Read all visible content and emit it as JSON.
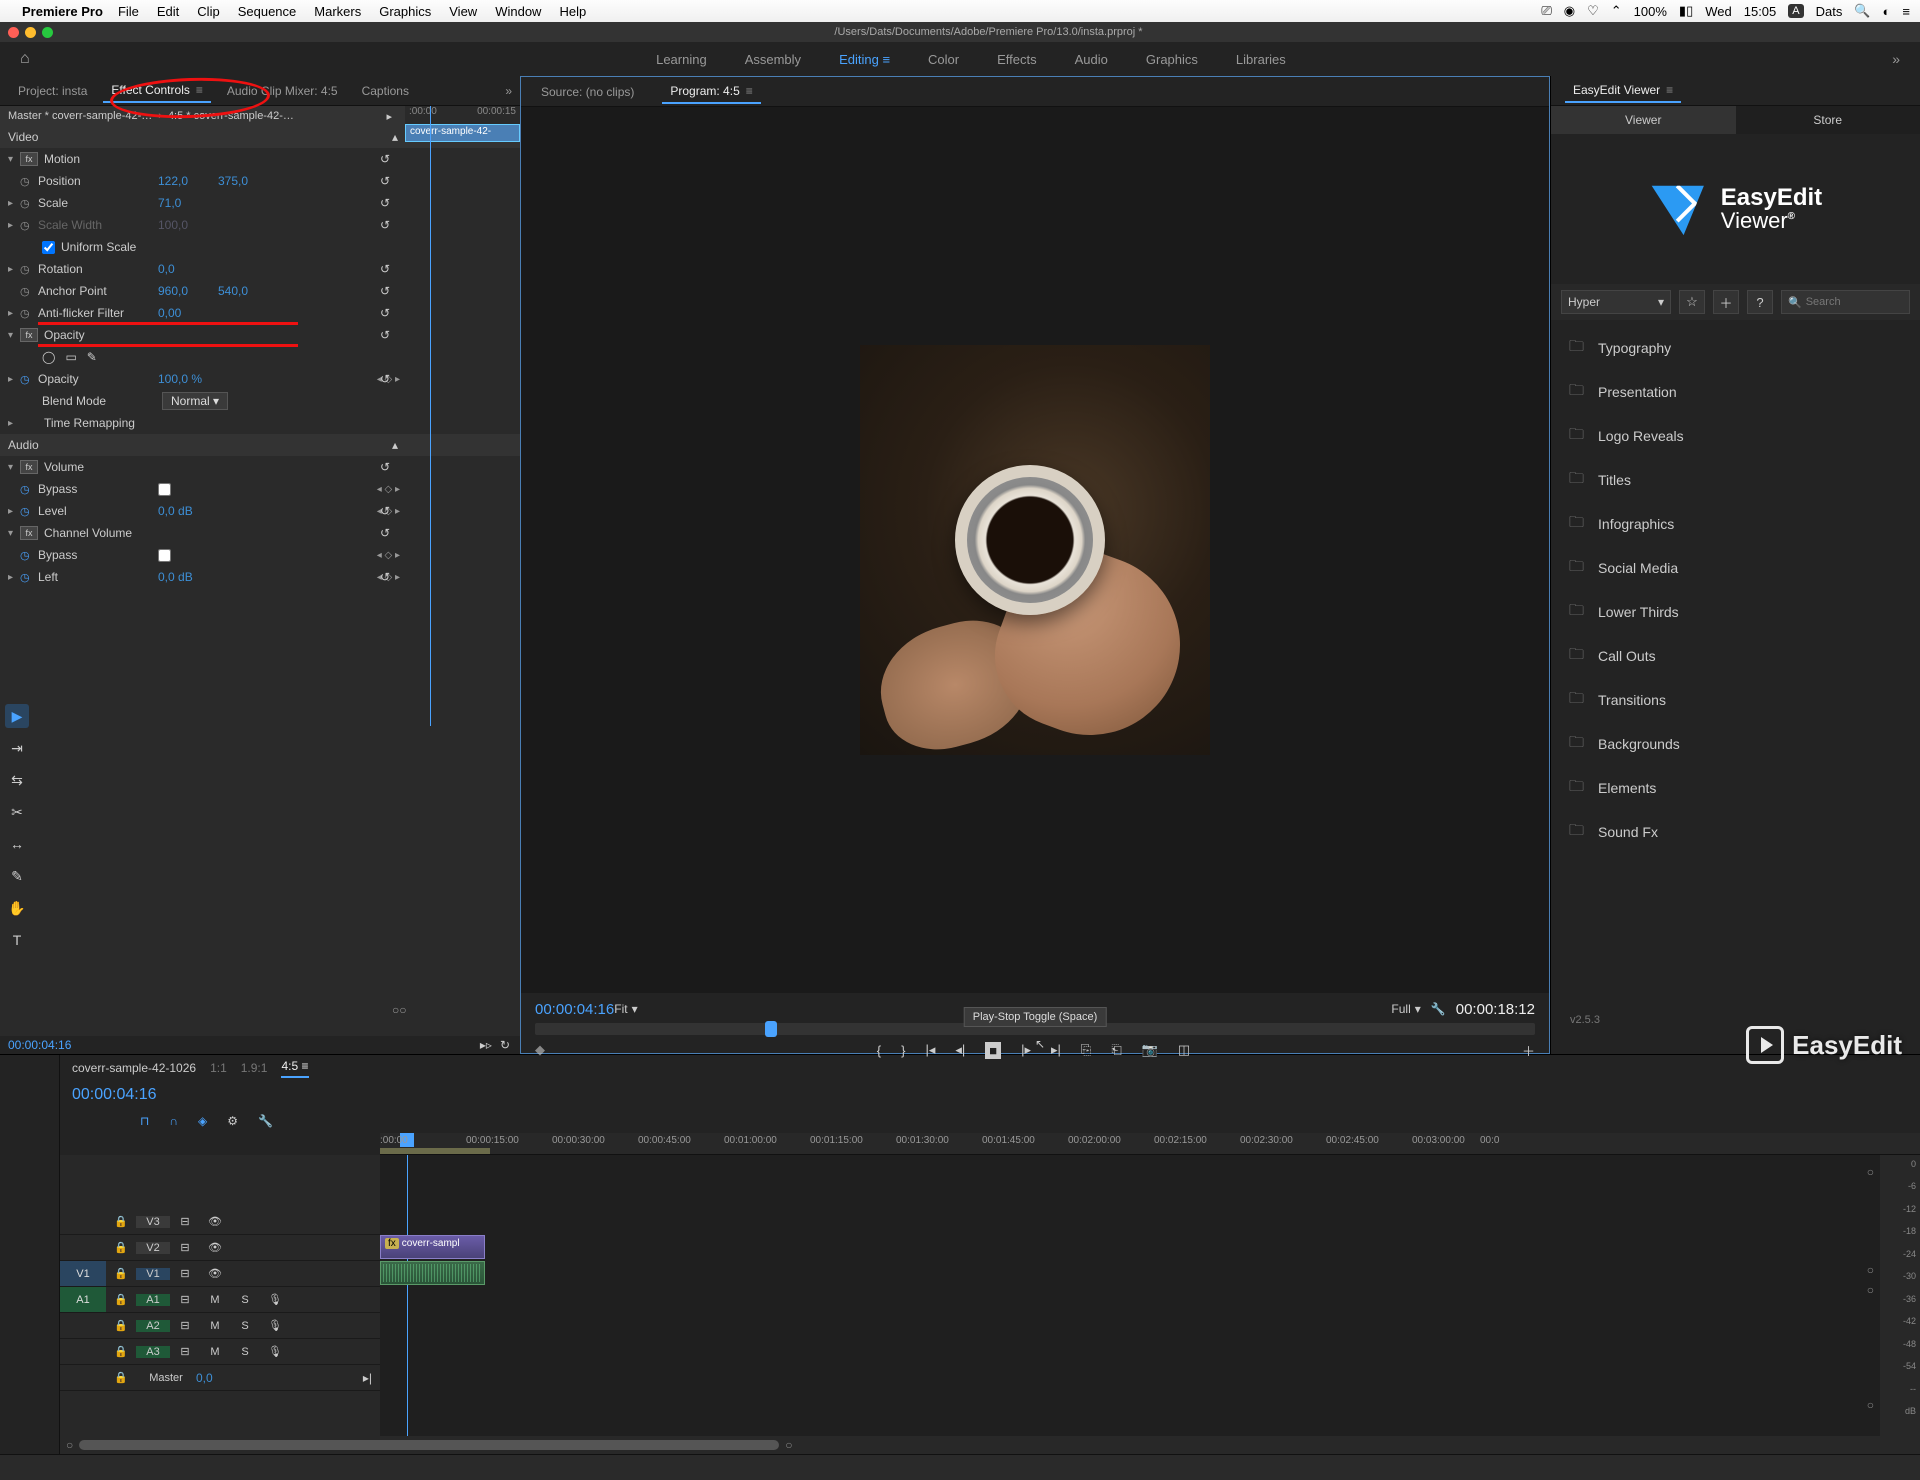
{
  "menubar": {
    "app": "Premiere Pro",
    "items": [
      "File",
      "Edit",
      "Clip",
      "Sequence",
      "Markers",
      "Graphics",
      "View",
      "Window",
      "Help"
    ],
    "right": {
      "battery": "100%",
      "day": "Wed",
      "time": "15:05",
      "user": "Dats"
    }
  },
  "titlebar": {
    "path": "/Users/Dats/Documents/Adobe/Premiere Pro/13.0/insta.prproj *"
  },
  "workspaces": {
    "items": [
      "Learning",
      "Assembly",
      "Editing",
      "Color",
      "Effects",
      "Audio",
      "Graphics",
      "Libraries"
    ],
    "active": "Editing"
  },
  "left_tabs": {
    "project": "Project: insta",
    "ec": "Effect Controls",
    "mixer": "Audio Clip Mixer: 4:5",
    "captions": "Captions"
  },
  "ec": {
    "master": "Master * coverr-sample-42-…",
    "clip": "4:5 * coverr-sample-42-…",
    "mini_t0": ":00:00",
    "mini_t1": "00:00:15",
    "clipstrip": "coverr-sample-42-",
    "sec_video": "Video",
    "motion": "Motion",
    "position": "Position",
    "pos_x": "122,0",
    "pos_y": "375,0",
    "scale": "Scale",
    "scale_v": "71,0",
    "scalew": "Scale Width",
    "scalew_v": "100,0",
    "uniform": "Uniform Scale",
    "rotation": "Rotation",
    "rotation_v": "0,0",
    "anchor": "Anchor Point",
    "anchor_x": "960,0",
    "anchor_y": "540,0",
    "antif": "Anti-flicker Filter",
    "antif_v": "0,00",
    "opacity_sec": "Opacity",
    "opacity": "Opacity",
    "opacity_v": "100,0 %",
    "blend": "Blend Mode",
    "blend_v": "Normal",
    "time_remap": "Time Remapping",
    "sec_audio": "Audio",
    "volume": "Volume",
    "bypass": "Bypass",
    "level": "Level",
    "level_v": "0,0 dB",
    "chvol": "Channel Volume",
    "left": "Left",
    "left_v": "0,0 dB",
    "foot_tc": "00:00:04:16"
  },
  "prog": {
    "source_tab": "Source: (no clips)",
    "program_tab": "Program: 4:5",
    "tc_cur": "00:00:04:16",
    "zoom": "Fit",
    "res": "Full",
    "tc_dur": "00:00:18:12",
    "tooltip": "Play-Stop Toggle (Space)"
  },
  "timeline": {
    "seq1": "coverr-sample-42-1026",
    "seq1_ratio": "1:1",
    "seq2_ratio": "1.9:1",
    "seq3": "4:5",
    "tc": "00:00:04:16",
    "ruler": [
      ":00:00",
      "00:00:15:00",
      "00:00:30:00",
      "00:00:45:00",
      "00:01:00:00",
      "00:01:15:00",
      "00:01:30:00",
      "00:01:45:00",
      "00:02:00:00",
      "00:02:15:00",
      "00:02:30:00",
      "00:02:45:00",
      "00:03:00:00",
      "00:0"
    ],
    "tracks_v": [
      "V3",
      "V2",
      "V1"
    ],
    "tracks_a": [
      "A1",
      "A2",
      "A3"
    ],
    "master": "Master",
    "master_v": "0,0",
    "src_v": "V1",
    "src_a": "A1",
    "clip_name": "coverr-sampl",
    "vu": [
      "0",
      "-6",
      "-12",
      "-18",
      "-24",
      "-30",
      "-36",
      "-42",
      "-48",
      "-54",
      "--",
      "dB"
    ]
  },
  "ee": {
    "panel": "EasyEdit Viewer",
    "tab_viewer": "Viewer",
    "tab_store": "Store",
    "logo1": "EasyEdit",
    "logo2": "Viewer",
    "dd": "Hyper",
    "search_ph": "Search",
    "cats": [
      "Typography",
      "Presentation",
      "Logo Reveals",
      "Titles",
      "Infographics",
      "Social Media",
      "Lower Thirds",
      "Call Outs",
      "Transitions",
      "Backgrounds",
      "Elements",
      "Sound Fx"
    ],
    "ver": "v2.5.3"
  }
}
